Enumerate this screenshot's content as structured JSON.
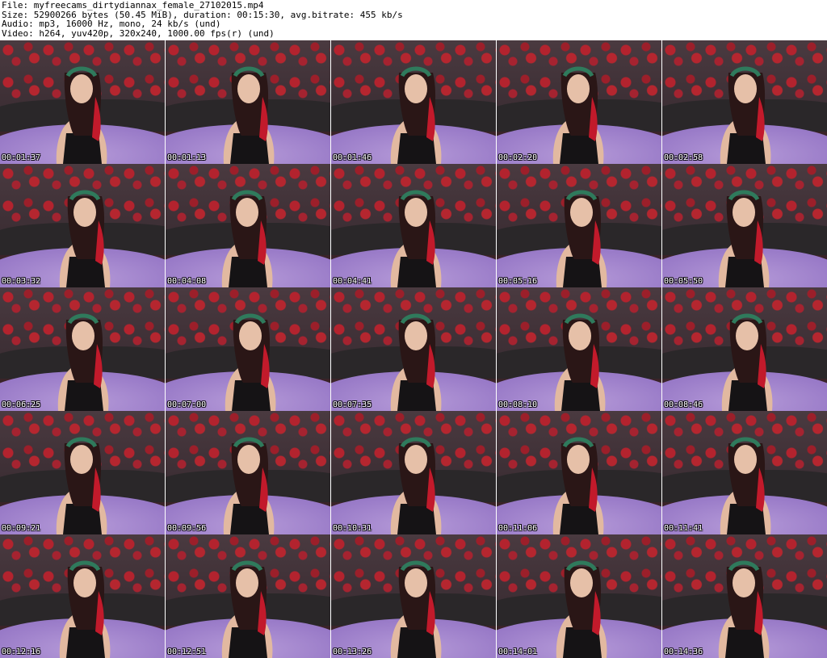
{
  "header": {
    "file_line": "File: myfreecams_dirtydiannax_female_27102015.mp4",
    "size_line": "Size: 52900266 bytes (50.45 MiB), duration: 00:15:30, avg.bitrate: 455 kb/s",
    "audio_line": "Audio: mp3, 16000 Hz, mono, 24 kb/s (und)",
    "video_line": "Video: h264, yuv420p, 320x240, 1000.00 fps(r) (und)"
  },
  "thumbnails": [
    "00:01:37",
    "00:01:13",
    "00:01:46",
    "00:02:20",
    "00:02:58",
    "00:03:32",
    "00:04:08",
    "00:04:41",
    "00:05:16",
    "00:05:50",
    "00:06:25",
    "00:07:00",
    "00:07:35",
    "00:08:10",
    "00:08:46",
    "00:09:21",
    "00:09:56",
    "00:10:31",
    "00:11:06",
    "00:11:41",
    "00:12:16",
    "00:12:51",
    "00:13:26",
    "00:14:01",
    "00:14:36"
  ]
}
